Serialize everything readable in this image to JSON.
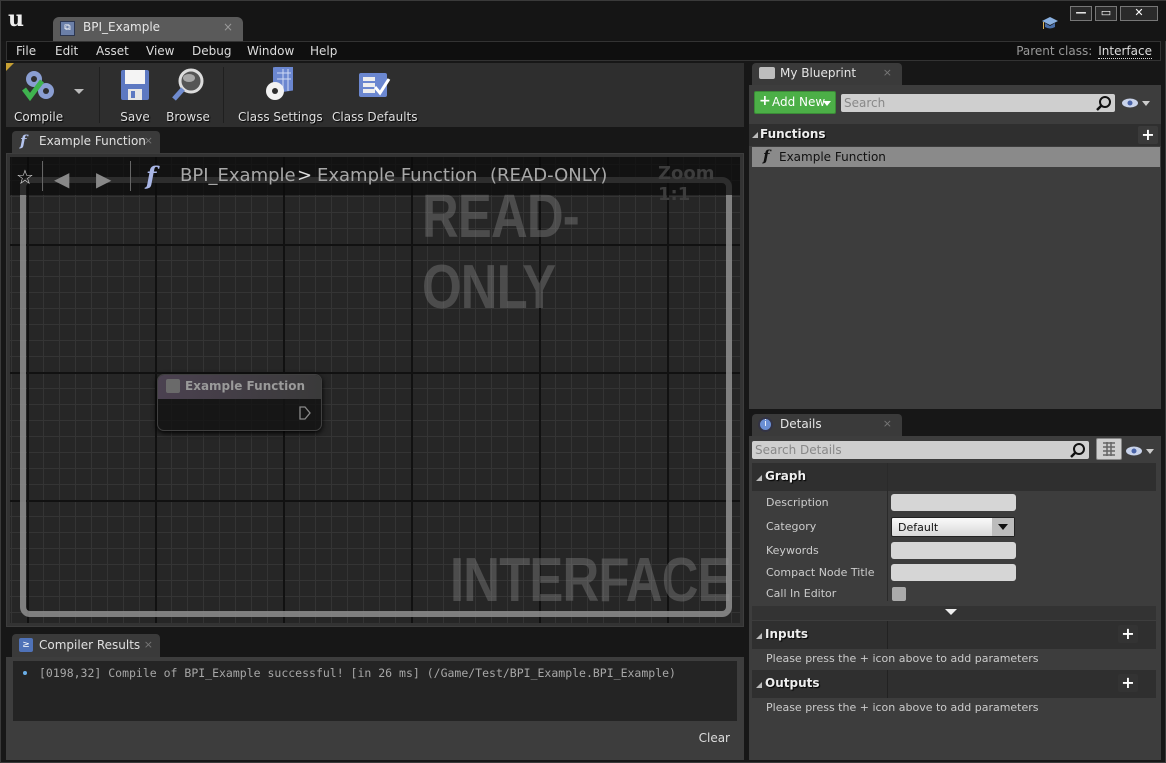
{
  "window": {
    "doc_tab": "BPI_Example",
    "controls": {
      "minimize": "—",
      "maximize": "▭",
      "close": "✕"
    }
  },
  "menu": {
    "items": [
      "File",
      "Edit",
      "Asset",
      "View",
      "Debug",
      "Window",
      "Help"
    ],
    "parent_class_label": "Parent class:",
    "parent_class_value": "Interface"
  },
  "toolbar": {
    "compile": "Compile",
    "save": "Save",
    "browse": "Browse",
    "class_settings": "Class Settings",
    "class_defaults": "Class Defaults"
  },
  "graph": {
    "tab_label": "Example Function",
    "breadcrumb_root": "BPI_Example",
    "breadcrumb_sep": ">",
    "breadcrumb_current": "Example Function",
    "read_only_tag": "(READ-ONLY)",
    "zoom": "Zoom 1:1",
    "watermark_top": "READ-ONLY",
    "watermark_bottom": "INTERFACE",
    "node_title": "Example Function"
  },
  "compiler": {
    "tab_label": "Compiler Results",
    "message": "[0198,32] Compile of BPI_Example successful! [in 26 ms] (/Game/Test/BPI_Example.BPI_Example)",
    "clear": "Clear"
  },
  "my_blueprint": {
    "tab_label": "My Blueprint",
    "add_new": "Add New",
    "search_placeholder": "Search",
    "functions_header": "Functions",
    "functions": [
      "Example Function"
    ]
  },
  "details": {
    "tab_label": "Details",
    "search_placeholder": "Search Details",
    "graph_section": "Graph",
    "props": {
      "description": "Description",
      "category": "Category",
      "category_value": "Default",
      "keywords": "Keywords",
      "compact_node_title": "Compact Node Title",
      "call_in_editor": "Call In Editor"
    },
    "inputs_section": "Inputs",
    "inputs_hint": "Please press the + icon above to add parameters",
    "outputs_section": "Outputs",
    "outputs_hint": "Please press the + icon above to add parameters"
  }
}
